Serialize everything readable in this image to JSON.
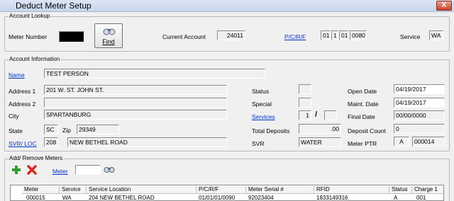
{
  "window": {
    "title": "Deduct Meter Setup",
    "close_label": "X"
  },
  "lookup": {
    "legend": "Account Lookup",
    "meter_number_label": "Meter Number",
    "find_label": "Find",
    "current_account_label": "Current Account",
    "current_account_value": "24011",
    "pcrf_label": "P/C/R/F",
    "pcrf_values": [
      "01",
      "1",
      "01",
      "0080"
    ],
    "service_label": "Service",
    "service_value": "WA"
  },
  "info": {
    "legend": "Account Information",
    "name_label": "Name",
    "name_value": "TEST PERSON",
    "address1_label": "Address 1",
    "address1_value": "201 W. ST. JOHN ST.",
    "address2_label": "Address 2",
    "address2_value": "",
    "city_label": "City",
    "city_value": "SPARTANBURG",
    "state_label": "State",
    "state_value": "SC",
    "zip_label": "Zip",
    "zip_value": "29349",
    "svrloc_label": "SVR/ LOC",
    "svrloc_num": "208",
    "svrloc_value": "NEW BETHEL ROAD",
    "status_label": "Status",
    "status_value": "",
    "special_label": "Special",
    "special_value": "",
    "services_label": "Services",
    "services_value1": "1",
    "services_sep": "/",
    "services_value2": "",
    "total_deposits_label": "Total Deposits",
    "total_deposits_value": ".00",
    "svr_label": "SVR",
    "svr_value": "WATER",
    "open_date_label": "Open Date",
    "open_date_value": "04/19/2017",
    "maint_date_label": "Maint. Date",
    "maint_date_value": "04/19/2017",
    "final_date_label": "Final Date",
    "final_date_value": "00/00/0000",
    "deposit_count_label": "Deposit Count",
    "deposit_count_value": "0",
    "meter_ptr_label": "Meter PTR",
    "meter_ptr_a": "A",
    "meter_ptr_value": "000014"
  },
  "meters": {
    "legend": "Add/ Remove Meters",
    "meter_label": "Meter",
    "meter_value": "",
    "columns": [
      "Meter",
      "Service",
      "Service Location",
      "P/C/R/F",
      "Meter Serial #",
      "RFID",
      "Status",
      "Charge 1"
    ],
    "rows": [
      [
        "000015",
        "WA",
        "204 NEW BETHEL ROAD",
        "01/01/01/0090",
        "92023404",
        "1833149316",
        "A",
        "001"
      ]
    ]
  },
  "colors": {
    "link": "#0033cc",
    "add_green": "#2e9e2e",
    "remove_red": "#d42b1e"
  }
}
